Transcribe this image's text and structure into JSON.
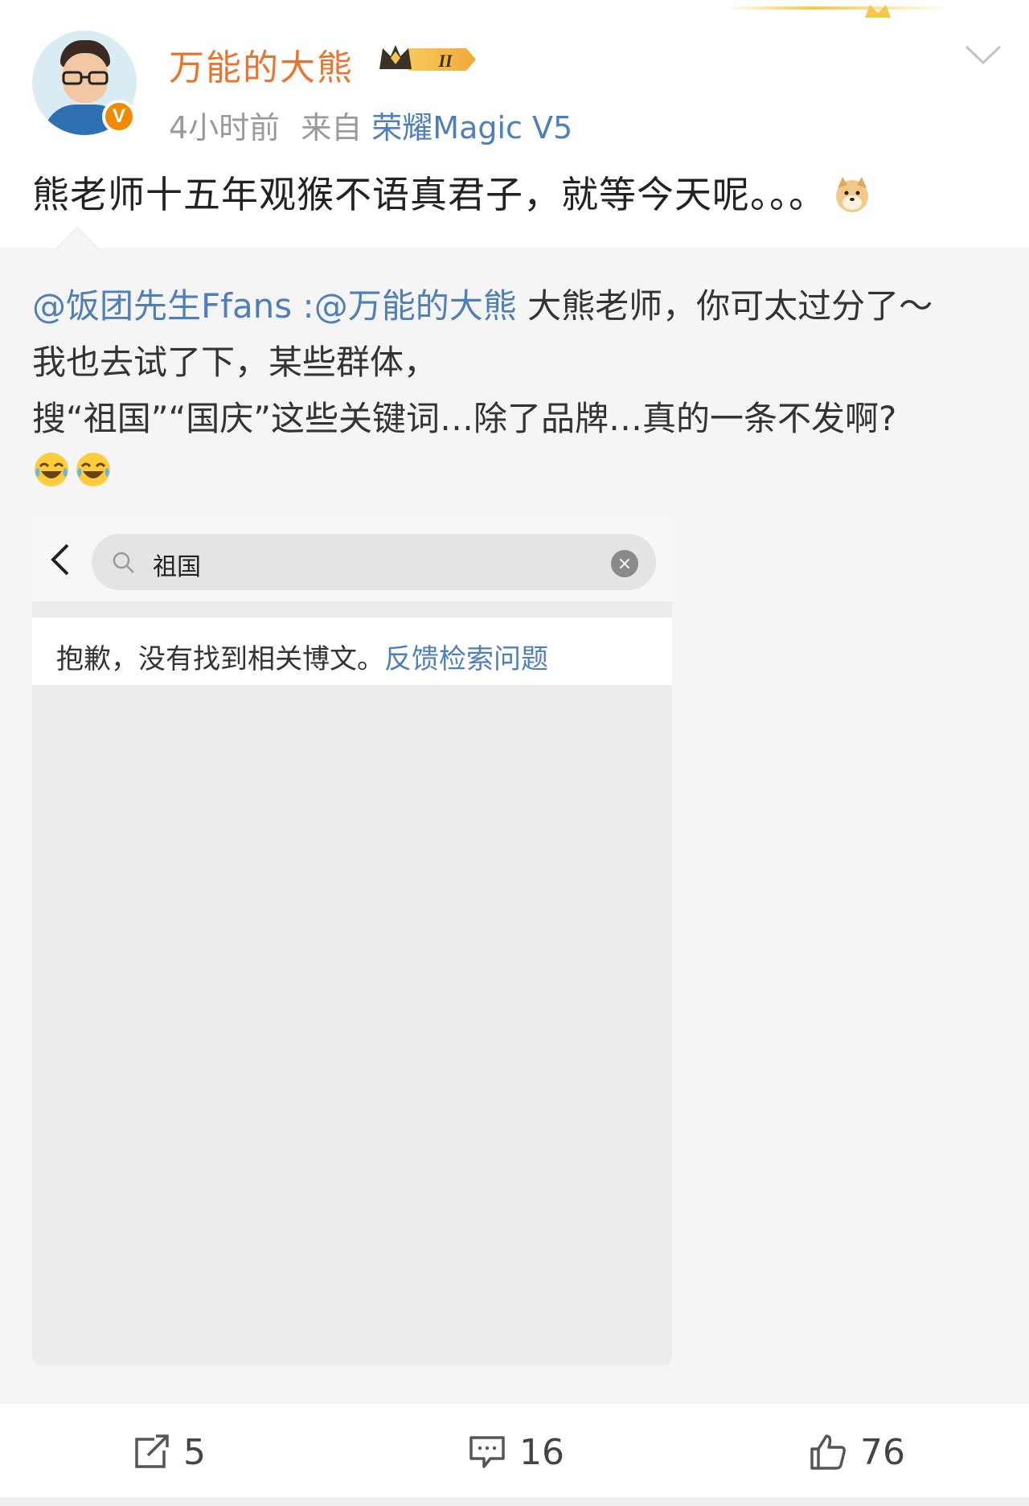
{
  "post": {
    "username": "万能的大熊",
    "vip_level": "II",
    "time": "4小时前",
    "source_prefix": "来自",
    "device": "荣耀Magic V5",
    "text": "熊老师十五年观猴不语真君子，就等今天呢。。。",
    "emoji": "doge-emoji",
    "verified_badge": "V"
  },
  "repost": {
    "mention_author": "@饭团先生Ffans",
    "separator": " :",
    "mention_target": "@万能的大熊",
    "line1_rest": " 大熊老师，你可太过分了～",
    "line2": "我也去试了下，某些群体，",
    "line3": "搜“祖国”“国庆”这些关键词…除了品牌…真的一条不发啊?",
    "emojis": [
      "laugh-cry-emoji",
      "laugh-cry-emoji"
    ],
    "screenshot": {
      "query": "祖国",
      "no_result_text": "抱歉，没有找到相关博文。",
      "feedback_link": "反馈检索问题"
    }
  },
  "actions": {
    "share_count": "5",
    "comment_count": "16",
    "like_count": "76"
  },
  "colors": {
    "username": "#e8742e",
    "link": "#4f7fb8",
    "meta": "#9a9a9a",
    "repost_bg": "#f5f5f5"
  }
}
